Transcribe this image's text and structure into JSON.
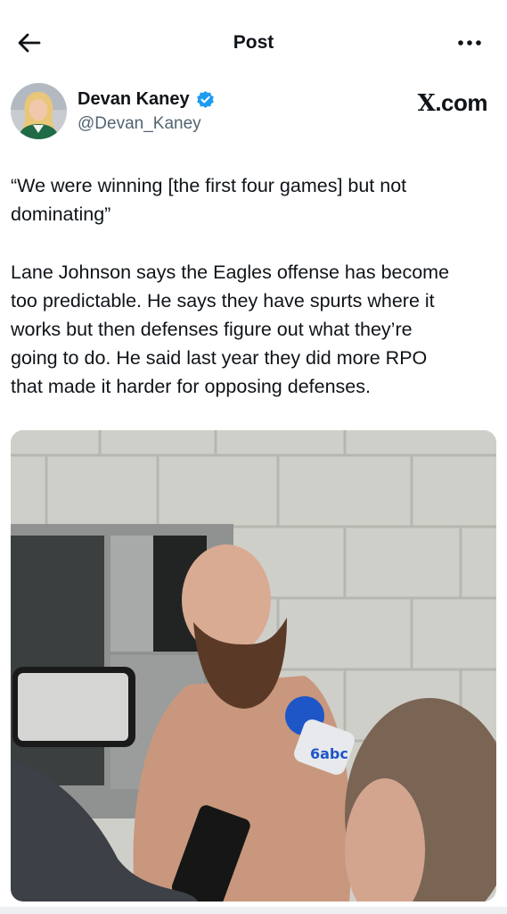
{
  "header": {
    "title": "Post"
  },
  "author": {
    "name": "Devan Kaney",
    "handle": "@Devan_Kaney",
    "verified": true,
    "avatar_icon": "profile-photo"
  },
  "watermark": {
    "text": ".com",
    "logo": "X"
  },
  "post": {
    "paragraph_1_line_1": "“We were winning [the first four games] but not",
    "paragraph_1_line_2": "dominating”",
    "paragraph_2_lines": [
      "Lane Johnson says the Eagles offense has become",
      "too predictable. He says they have spurts where it",
      "works but then defenses figure out what they’re",
      "going to do. He said last year they did more RPO",
      "that made it harder for opposing defenses."
    ]
  },
  "photo": {
    "microphone_logo": "6abc"
  },
  "colors": {
    "text": "#0f1419",
    "secondary": "#536471",
    "verified": "#1d9bf0",
    "mic": "#1e56c8"
  }
}
